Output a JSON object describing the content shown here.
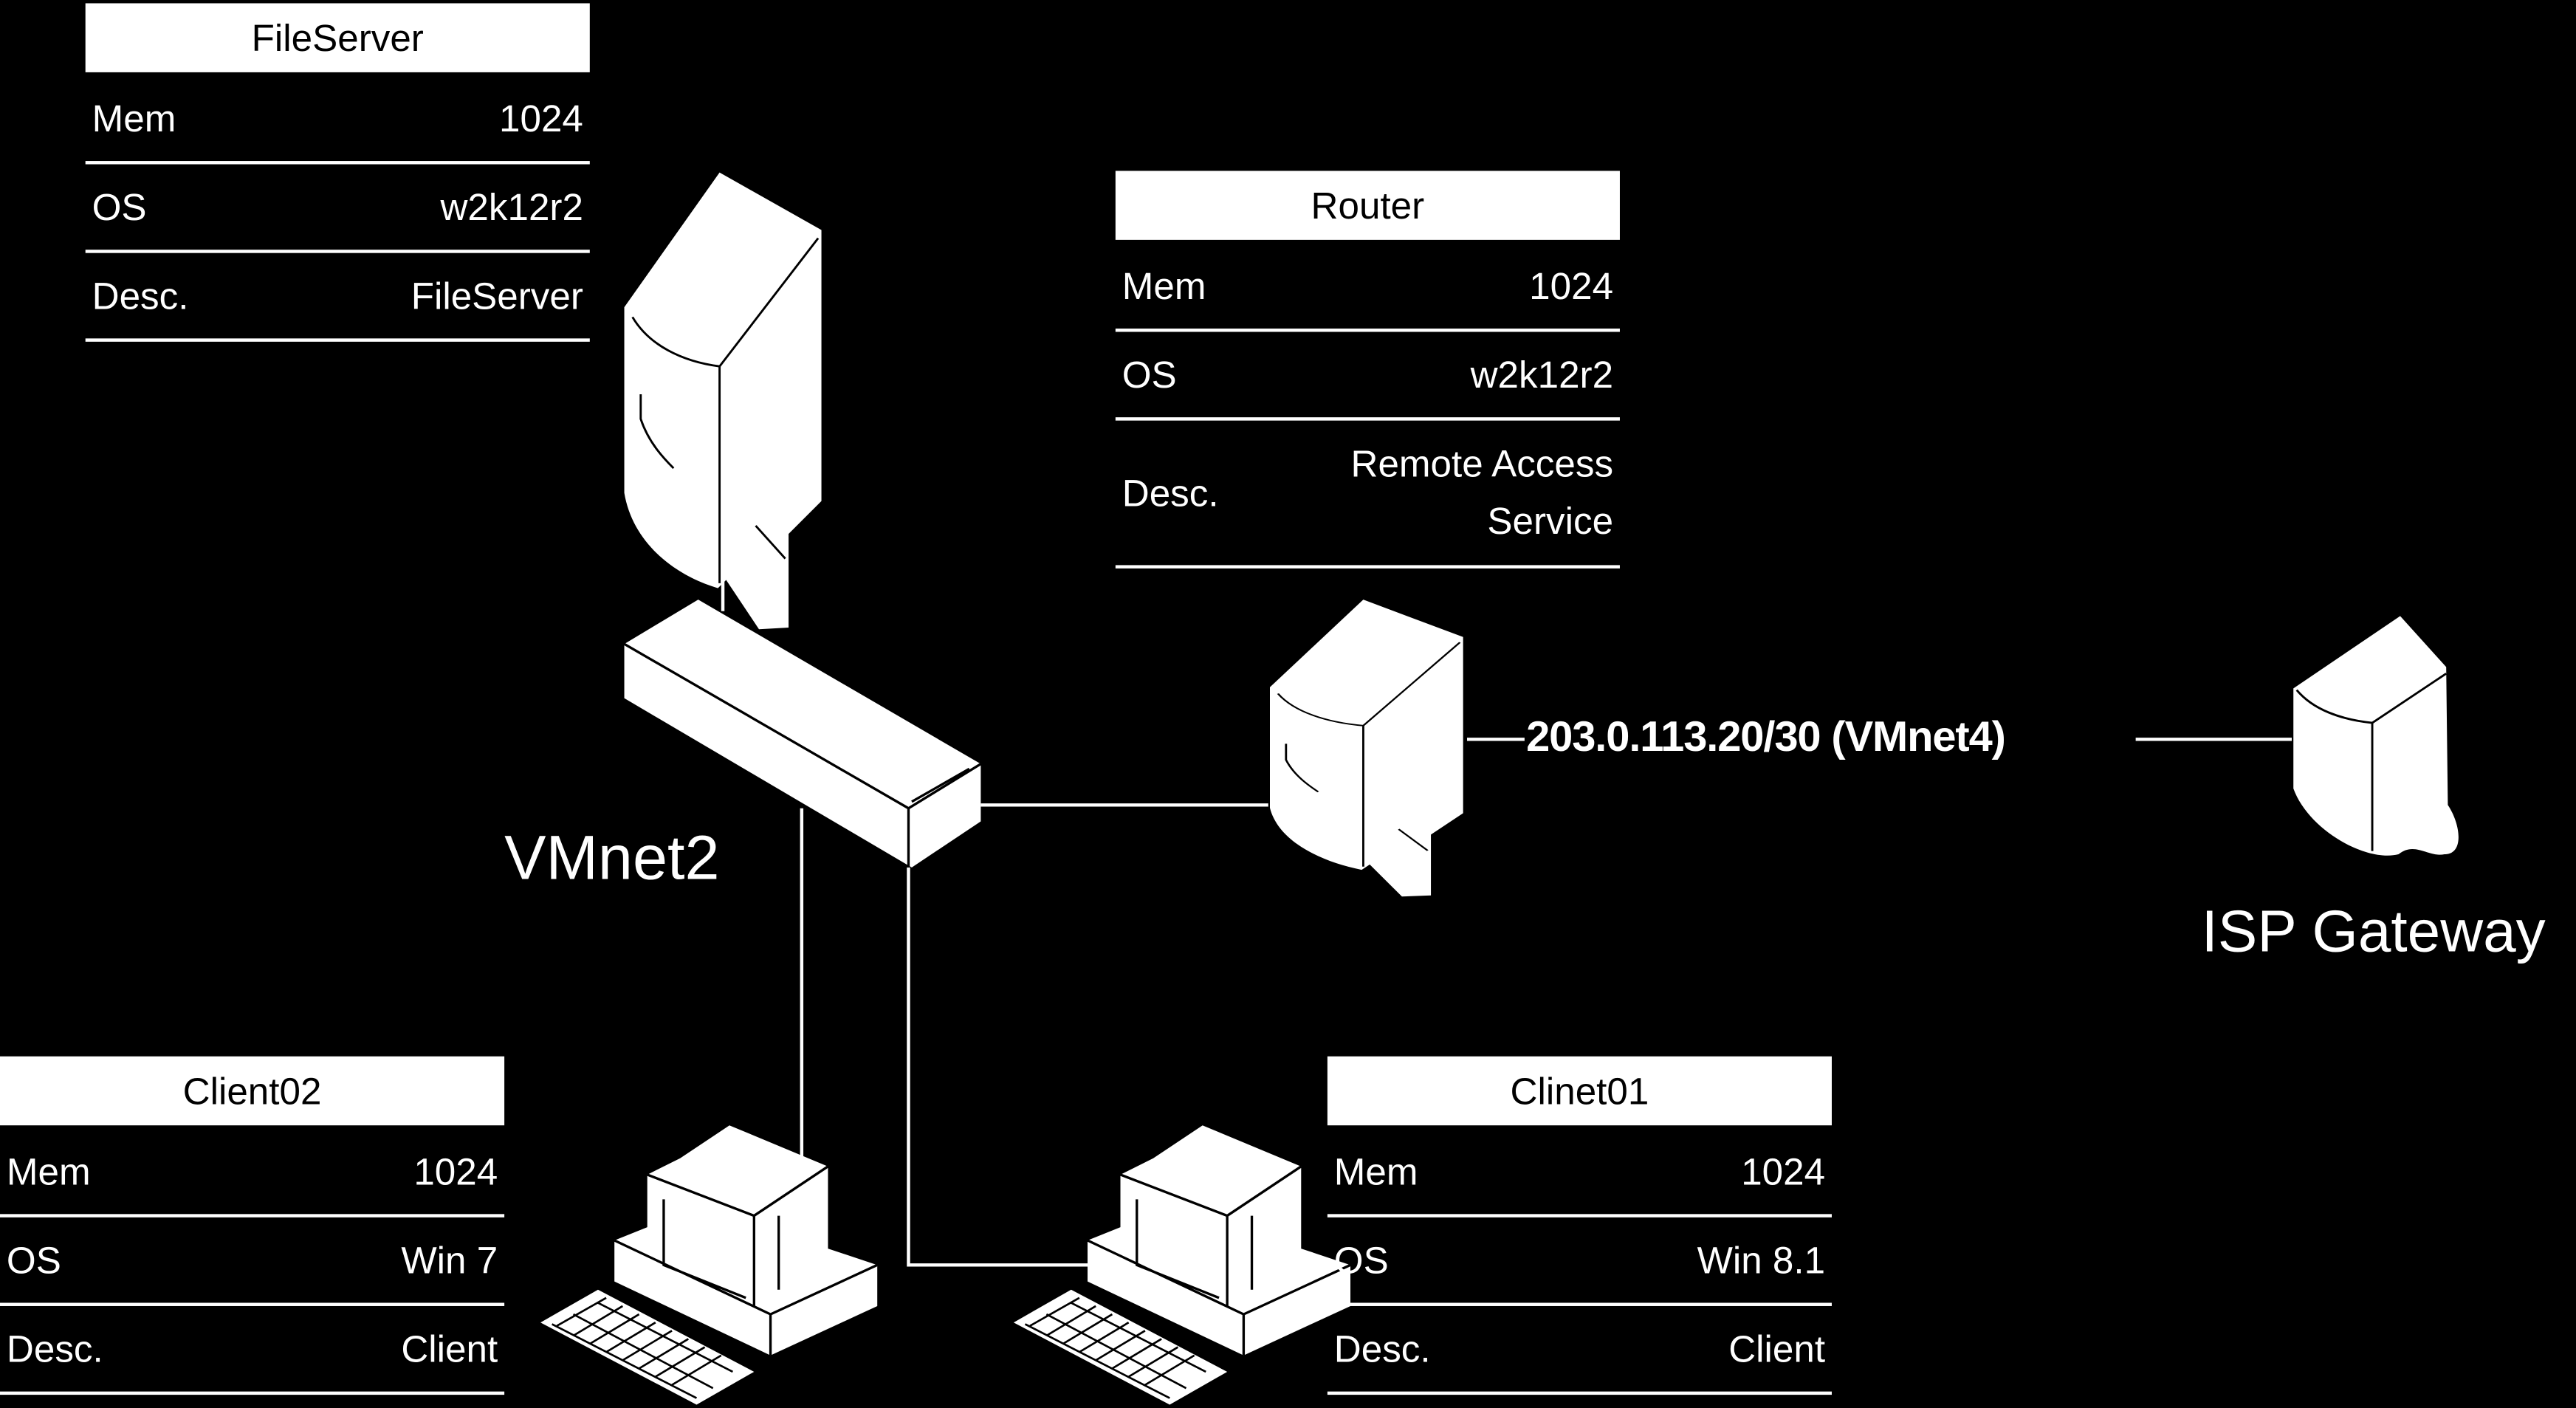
{
  "nodes": {
    "fileserver": {
      "title": "FileServer",
      "rows": [
        {
          "key": "Mem",
          "value": "1024"
        },
        {
          "key": "OS",
          "value": "w2k12r2"
        },
        {
          "key": "Desc.",
          "value": "FileServer"
        }
      ]
    },
    "router": {
      "title": "Router",
      "rows": [
        {
          "key": "Mem",
          "value": "1024"
        },
        {
          "key": "OS",
          "value": "w2k12r2"
        },
        {
          "key": "Desc.",
          "value": "Remote Access",
          "value2": "Service"
        }
      ]
    },
    "client02": {
      "title": "Client02",
      "rows": [
        {
          "key": "Mem",
          "value": "1024"
        },
        {
          "key": "OS",
          "value": "Win 7"
        },
        {
          "key": "Desc.",
          "value": "Client"
        }
      ]
    },
    "clinet01": {
      "title": "Clinet01",
      "rows": [
        {
          "key": "Mem",
          "value": "1024"
        },
        {
          "key": "OS",
          "value": "Win 8.1"
        },
        {
          "key": "Desc.",
          "value": "Client"
        }
      ]
    }
  },
  "labels": {
    "switch": "VMnet2",
    "link": "203.0.113.20/30 (VMnet4)",
    "isp": "ISP Gateway"
  },
  "colors": {
    "background": "#000000",
    "foreground": "#ffffff"
  }
}
